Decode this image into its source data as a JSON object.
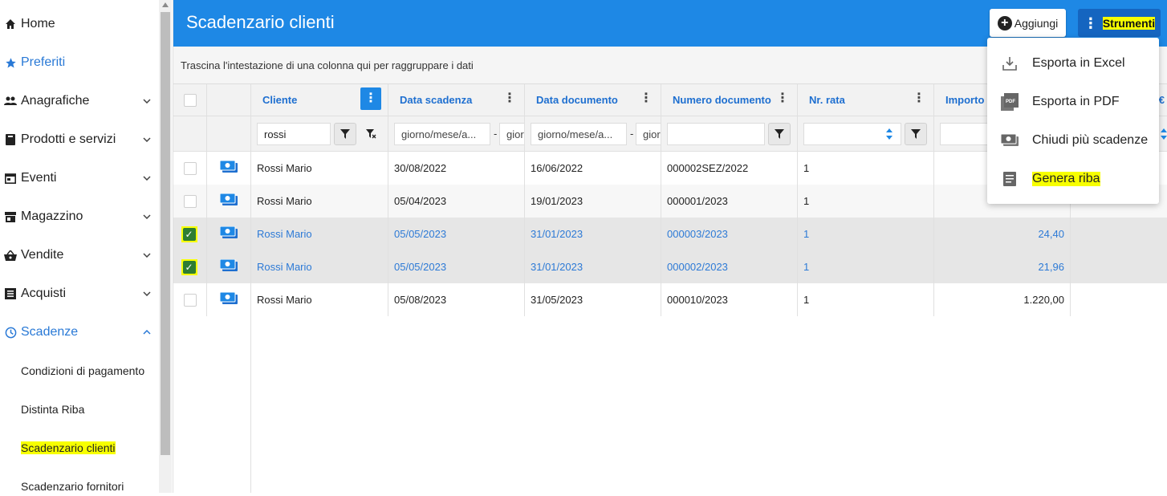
{
  "sidebar": {
    "items": [
      {
        "label": "Home",
        "icon": "home-icon"
      },
      {
        "label": "Preferiti",
        "icon": "star-icon"
      },
      {
        "label": "Anagrafiche",
        "icon": "people-icon"
      },
      {
        "label": "Prodotti e servizi",
        "icon": "book-icon"
      },
      {
        "label": "Eventi",
        "icon": "calendar-icon"
      },
      {
        "label": "Magazzino",
        "icon": "warehouse-icon"
      },
      {
        "label": "Vendite",
        "icon": "basket-icon"
      },
      {
        "label": "Acquisti",
        "icon": "list-icon"
      },
      {
        "label": "Scadenze",
        "icon": "clock-icon"
      }
    ],
    "sub_items": [
      {
        "label": "Condizioni di pagamento"
      },
      {
        "label": "Distinta Riba"
      },
      {
        "label": "Scadenzario clienti"
      },
      {
        "label": "Scadenzario fornitori"
      }
    ]
  },
  "header": {
    "title": "Scadenzario clienti",
    "add_label": "Aggiungi",
    "tools_label": "Strumenti"
  },
  "group_panel": {
    "hint": "Trascina l'intestazione di una colonna qui per raggruppare i dati"
  },
  "grid": {
    "columns": [
      "Cliente",
      "Data scadenza",
      "Data documento",
      "Numero documento",
      "Nr. rata",
      "Importo €",
      "€"
    ],
    "filters": {
      "cliente": "rossi",
      "date_from_placeholder": "giorno/mese/a...",
      "date_to_placeholder": "gior"
    },
    "rows": [
      {
        "cliente": "Rossi Mario",
        "data_scadenza": "30/08/2022",
        "data_documento": "16/06/2022",
        "numero_documento": "000002SEZ/2022",
        "nr_rata": "1",
        "importo": "",
        "selected": false
      },
      {
        "cliente": "Rossi Mario",
        "data_scadenza": "05/04/2023",
        "data_documento": "19/01/2023",
        "numero_documento": "000001/2023",
        "nr_rata": "1",
        "importo": "",
        "selected": false
      },
      {
        "cliente": "Rossi Mario",
        "data_scadenza": "05/05/2023",
        "data_documento": "31/01/2023",
        "numero_documento": "000003/2023",
        "nr_rata": "1",
        "importo": "24,40",
        "selected": true
      },
      {
        "cliente": "Rossi Mario",
        "data_scadenza": "05/05/2023",
        "data_documento": "31/01/2023",
        "numero_documento": "000002/2023",
        "nr_rata": "1",
        "importo": "21,96",
        "selected": true
      },
      {
        "cliente": "Rossi Mario",
        "data_scadenza": "05/08/2023",
        "data_documento": "31/05/2023",
        "numero_documento": "000010/2023",
        "nr_rata": "1",
        "importo": "1.220,00",
        "selected": false
      }
    ]
  },
  "tools_menu": {
    "items": [
      {
        "label": "Esporta in Excel",
        "icon": "download-icon"
      },
      {
        "label": "Esporta in PDF",
        "icon": "pdf-icon"
      },
      {
        "label": "Chiudi più scadenze",
        "icon": "money-icon"
      },
      {
        "label": "Genera riba",
        "icon": "document-icon"
      }
    ]
  },
  "colors": {
    "primary": "#1e88e5",
    "highlight": "#f7ff00",
    "link": "#1e6fd0",
    "check": "#2e7d32"
  }
}
